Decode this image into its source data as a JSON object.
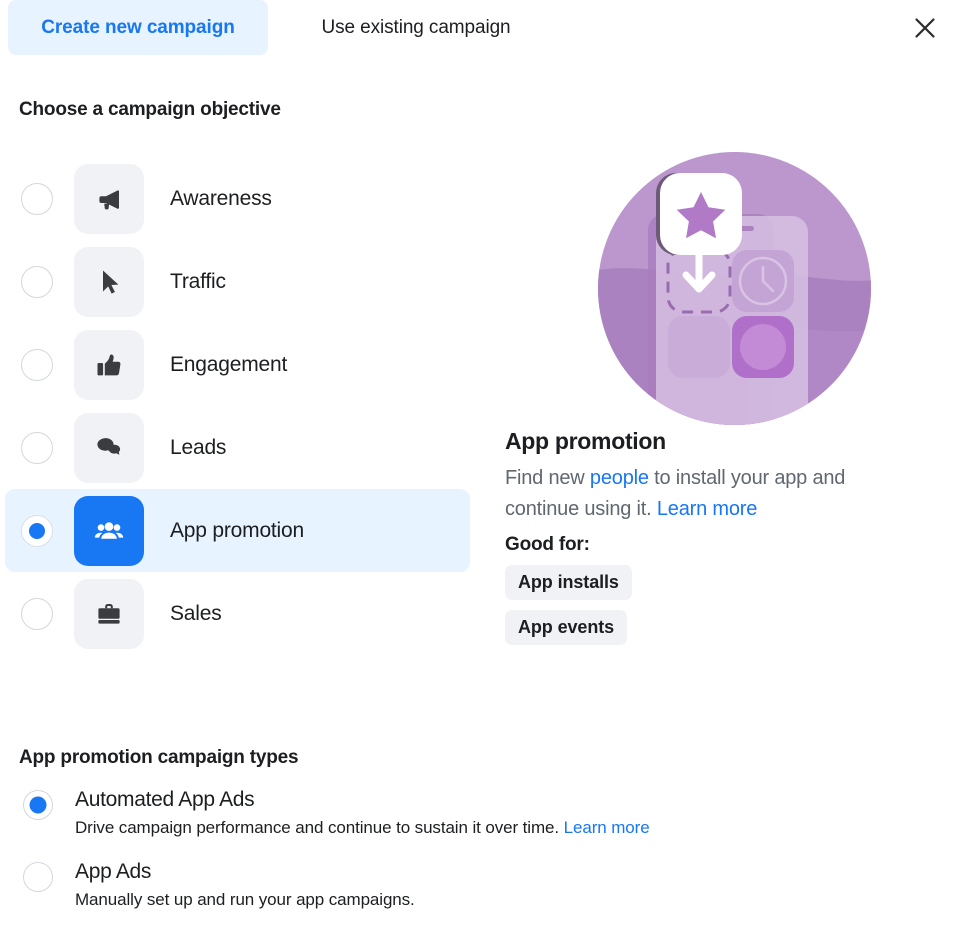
{
  "tabs": [
    {
      "id": "create-new",
      "label": "Create new campaign",
      "active": true
    },
    {
      "id": "use-existing",
      "label": "Use existing campaign",
      "active": false
    }
  ],
  "close_icon": "close-icon",
  "objective_section": {
    "title": "Choose a campaign objective",
    "options": [
      {
        "id": "awareness",
        "label": "Awareness",
        "icon": "megaphone-icon",
        "selected": false
      },
      {
        "id": "traffic",
        "label": "Traffic",
        "icon": "cursor-icon",
        "selected": false
      },
      {
        "id": "engagement",
        "label": "Engagement",
        "icon": "thumbs-up-icon",
        "selected": false
      },
      {
        "id": "leads",
        "label": "Leads",
        "icon": "chat-bubbles-icon",
        "selected": false
      },
      {
        "id": "app-promotion",
        "label": "App promotion",
        "icon": "people-icon",
        "selected": true
      },
      {
        "id": "sales",
        "label": "Sales",
        "icon": "briefcase-icon",
        "selected": false
      }
    ]
  },
  "detail": {
    "illustration": "app-promotion-illustration",
    "title": "App promotion",
    "description_part1": "Find new ",
    "description_link1": "people",
    "description_part2": " to install your app and continue using it. ",
    "description_link2": "Learn more",
    "good_for_label": "Good for:",
    "tags": [
      "App installs",
      "App events"
    ]
  },
  "campaign_types_section": {
    "title": "App promotion campaign types",
    "options": [
      {
        "id": "automated-app-ads",
        "label": "Automated App Ads",
        "description": "Drive campaign performance and continue to sustain it over time. ",
        "link": "Learn more",
        "selected": true
      },
      {
        "id": "app-ads",
        "label": "App Ads",
        "description": "Manually set up and run your app campaigns.",
        "link": "",
        "selected": false
      }
    ]
  },
  "colors": {
    "accent_blue": "#1877f2",
    "tab_active_bg": "#e7f3ff",
    "icon_bg": "#f0f2f5",
    "text_primary": "#1c1e21",
    "text_secondary": "#606770",
    "illustration_purple": "#b794c8"
  }
}
